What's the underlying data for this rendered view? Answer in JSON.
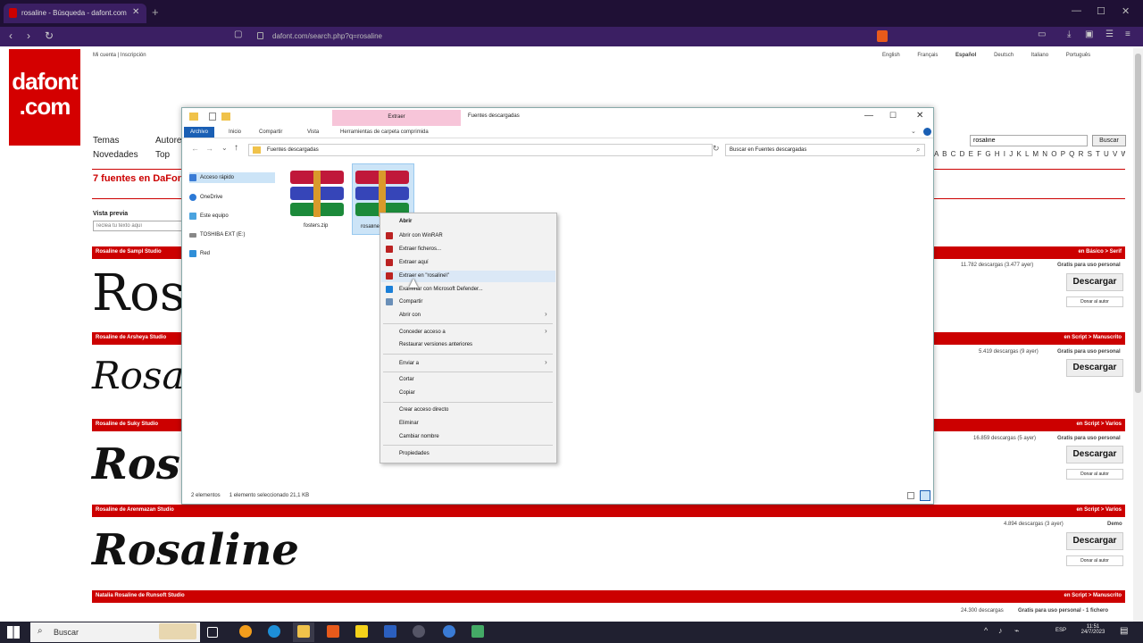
{
  "browser": {
    "tab_title": "rosaline - Búsqueda - dafont.com",
    "url": "dafont.com/search.php?q=rosaline"
  },
  "site": {
    "logo_line1": "dafont",
    "logo_line2": ".com",
    "top_links": "Mi cuenta | Inscripción",
    "languages": [
      "English",
      "Français",
      "Español",
      "Deutsch",
      "Italiano",
      "Português"
    ],
    "menu": [
      "Temas",
      "Autores",
      "Novedades",
      "Top"
    ],
    "search_value": "rosaline",
    "search_button": "Buscar",
    "alphabet": "A B C D E F G H I J K L M N O P Q R S T U V W X Y Z #",
    "results_title": "7 fuentes en DaFont",
    "preview_label": "Vista previa",
    "preview_placeholder": "Teclea tu texto aquí",
    "download_label": "Descargar",
    "author_label": "Donar al autor",
    "fonts": [
      {
        "bar": "Rosaline de Sampl Studio",
        "cat": "en Básico > Serif",
        "stats": "11.782 descargas (3.477 ayer)",
        "license": "Gratis para uso personal",
        "sample": "Ros"
      },
      {
        "bar": "Rosaline de Arsheya Studio",
        "cat": "en Script > Manuscrito",
        "stats": "5.419 descargas (9 ayer)",
        "license": "Gratis para uso personal",
        "sample": "Rosalin"
      },
      {
        "bar": "Rosaline de Suky Studio",
        "cat": "en Script > Varios",
        "stats": "16.859 descargas (5 ayer)",
        "license": "Gratis para uso personal",
        "sample": "Rosal"
      },
      {
        "bar": "Rosaline de Arenmazan Studio",
        "cat": "en Script > Varios",
        "stats": "4.894 descargas (3 ayer)",
        "license": "Demo",
        "sample": "Rosaline"
      },
      {
        "bar": "Natalia Rosaline de Runsoft Studio",
        "cat": "en Script > Manuscrito",
        "stats": "24.300 descargas",
        "license": "Gratis para uso personal - 1 fichero",
        "sample": ""
      }
    ]
  },
  "explorer": {
    "extract_tab": "Extraer",
    "title": "Fuentes descargadas",
    "ribbon_tabs": [
      "Archivo",
      "Inicio",
      "Compartir",
      "Vista",
      "Herramientas de carpeta comprimida"
    ],
    "address": "Fuentes descargadas",
    "search_placeholder": "Buscar en Fuentes descargadas",
    "sidebar": [
      "Acceso rápido",
      "OneDrive",
      "Este equipo",
      "TOSHIBA EXT (E:)",
      "Red"
    ],
    "files": [
      {
        "name": "fosters.zip"
      },
      {
        "name": "rosaline.zip"
      }
    ],
    "status_items": "2 elementos",
    "status_selected": "1 elemento seleccionado  21,1 KB"
  },
  "context_menu": [
    {
      "label": "Abrir",
      "bold": true
    },
    {
      "label": "Abrir con WinRAR"
    },
    {
      "label": "Extraer ficheros..."
    },
    {
      "label": "Extraer aquí"
    },
    {
      "label": "Extraer en \"rosaline\\\""
    },
    {
      "label": "Examinar con Microsoft Defender..."
    },
    {
      "label": "Compartir"
    },
    {
      "label": "Abrir con"
    },
    {
      "label": "Conceder acceso a"
    },
    {
      "label": "Restaurar versiones anteriores"
    },
    {
      "label": "Enviar a"
    },
    {
      "label": "Cortar"
    },
    {
      "label": "Copiar"
    },
    {
      "label": "Crear acceso directo"
    },
    {
      "label": "Eliminar"
    },
    {
      "label": "Cambiar nombre"
    },
    {
      "label": "Propiedades"
    }
  ],
  "taskbar": {
    "search": "Buscar",
    "time": "11:51",
    "date": "24/7/2023",
    "lang": "ESP"
  },
  "colors": {
    "brand_red": "#cc0000",
    "browser_purple": "#3b1f63",
    "winrar_red": "#c0183a",
    "winrar_blue": "#3645b8",
    "winrar_green": "#1c8a3a"
  }
}
